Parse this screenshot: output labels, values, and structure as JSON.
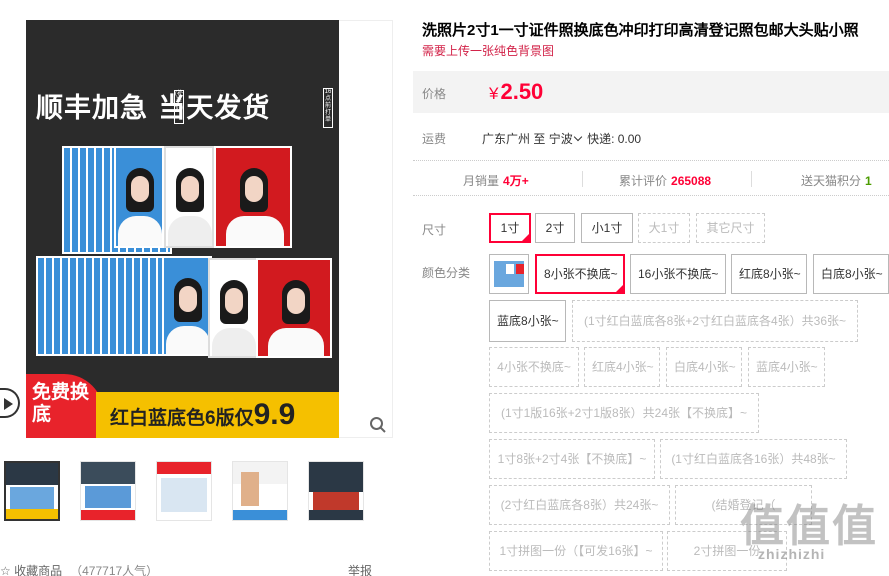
{
  "gallery": {
    "main_image": {
      "headline": "顺丰加急 当天发货",
      "vertical_tag_left": "(补差价)",
      "vertical_tag_right": "16点前打单",
      "promo_free": "免费换底",
      "promo_bar_text": "红白蓝底色6版仅",
      "promo_bar_price": "9.9"
    },
    "thumbnails": [
      "thumb1",
      "thumb2",
      "thumb3",
      "thumb4",
      "thumb5"
    ],
    "favorite_label": "收藏商品",
    "favorite_count": "（477717人气）",
    "report_label": "举报"
  },
  "product": {
    "title": "洗照片2寸1一寸证件照换底色冲印打印高清登记照包邮大头贴小照",
    "subtitle": "需要上传一张纯色背景图",
    "price_label": "价格",
    "currency": "¥",
    "price": "2.50",
    "shipping_label": "运费",
    "shipping_from": "广东广州",
    "shipping_to_word": "至",
    "shipping_to": "宁波",
    "shipping_fee": "快递: 0.00",
    "stats": {
      "monthly_sales_label": "月销量",
      "monthly_sales": "4万+",
      "reviews_label": "累计评价",
      "reviews": "265088",
      "points_label": "送天猫积分",
      "points": "1"
    }
  },
  "options": {
    "size_label": "尺寸",
    "sizes": [
      "1寸",
      "2寸",
      "小1寸",
      "大1寸",
      "其它尺寸"
    ],
    "color_label": "颜色分类",
    "colors": [
      "8小张不换底~",
      "16小张不换底~",
      "红底8小张~",
      "白底8小张~",
      "蓝底8小张~",
      "(1寸红白蓝底各8张+2寸红白蓝底各4张）共36张~",
      "4小张不换底~",
      "红底4小张~",
      "白底4小张~",
      "蓝底4小张~",
      "(1寸1版16张+2寸1版8张）共24张【不换底】~",
      "1寸8张+2寸4张【不换底】~",
      "(1寸红白蓝底各16张）共48张~",
      "(2寸红白蓝底各8张）共24张~",
      "(结婚登记（",
      "1寸拼图一份（【可发16张】~",
      "2寸拼图一份"
    ]
  },
  "watermark": {
    "main": "值值值",
    "sub": "zhizhizhi"
  },
  "colors": {
    "accent": "#ff0036",
    "subtitle": "#d22147",
    "green": "#4b9c00"
  }
}
